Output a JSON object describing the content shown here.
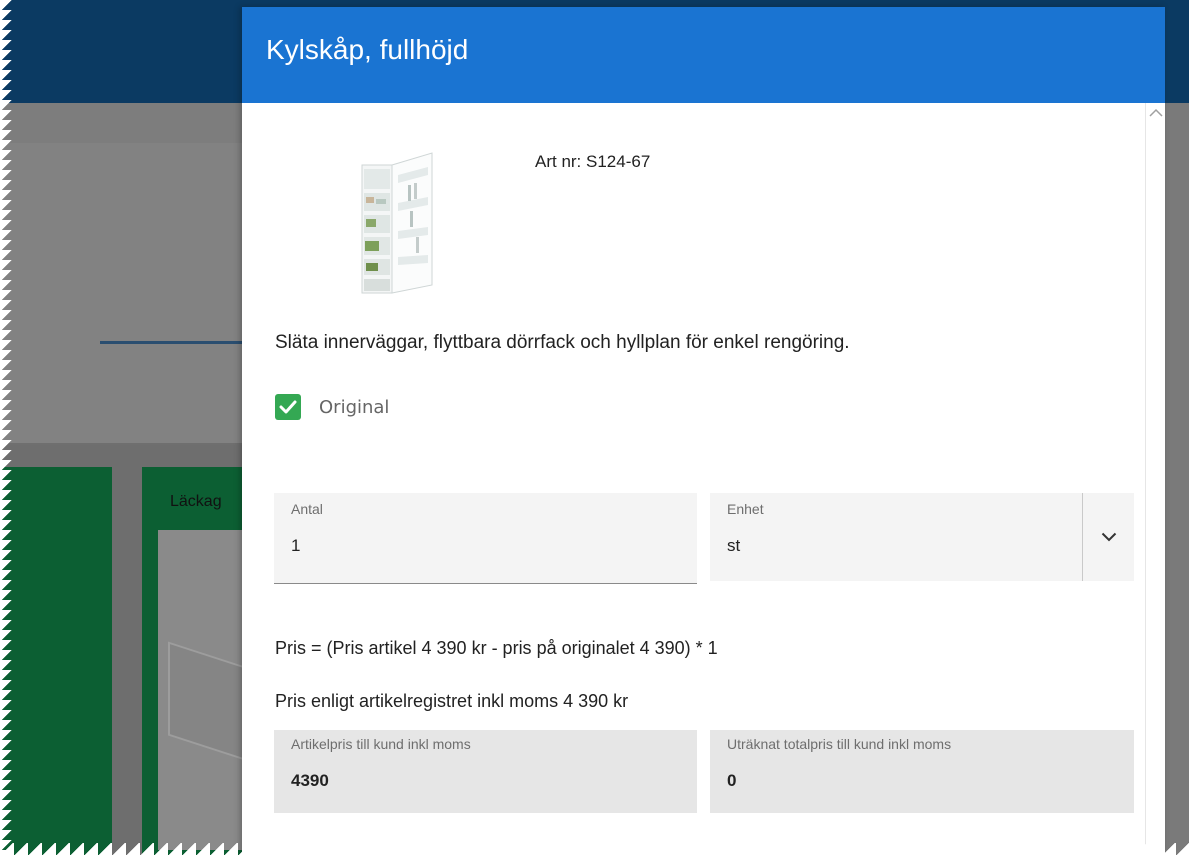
{
  "dialog": {
    "title": "Kylskåp, fullhöjd",
    "art_nr": "Art nr: S124-67",
    "description": "Släta innerväggar, flyttbara dörrfack och hyllplan för enkel rengöring.",
    "original": {
      "label": "Original",
      "checked": true
    },
    "antal": {
      "label": "Antal",
      "value": "1"
    },
    "enhet": {
      "label": "Enhet",
      "value": "st"
    },
    "pris_formula": "Pris = (Pris artikel 4 390 kr - pris på originalet 4 390) * 1",
    "pris_register": "Pris enligt artikelregistret inkl moms 4 390 kr",
    "artikelpris": {
      "label": "Artikelpris till kund inkl moms",
      "value": "4390"
    },
    "totalpris": {
      "label": "Uträknat totalpris till kund inkl moms",
      "value": "0"
    }
  },
  "background": {
    "card_label": "Läckag"
  },
  "colors": {
    "header_blue": "#1a74d2",
    "checkbox_green": "#34a853",
    "background_navy": "#0b3a62",
    "background_card_green": "#0c5f33"
  }
}
